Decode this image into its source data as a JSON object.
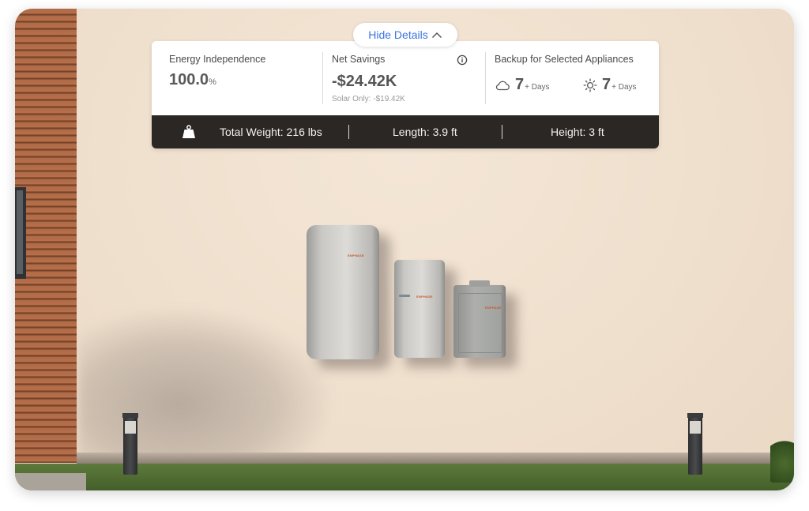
{
  "toggle": {
    "label": "Hide Details"
  },
  "stats": {
    "energy_independence": {
      "label": "Energy Independence",
      "value": "100.0",
      "unit": "%"
    },
    "net_savings": {
      "label": "Net Savings",
      "value": "-$24.42K",
      "sub": "Solar Only: -$19.42K"
    },
    "backup": {
      "label": "Backup for Selected Appliances",
      "cloudy": {
        "value": "7",
        "unit": "+ Days",
        "icon": "cloud-icon"
      },
      "sunny": {
        "value": "7",
        "unit": "+ Days",
        "icon": "sun-icon"
      }
    }
  },
  "dimensions": {
    "weight": "Total Weight: 216 lbs",
    "length": "Length: 3.9 ft",
    "height": "Height: 3 ft"
  },
  "brand_mark": "ENPHASE",
  "colors": {
    "accent": "#3b74e0",
    "bar": "#2b2724",
    "brand": "#c2572b"
  }
}
